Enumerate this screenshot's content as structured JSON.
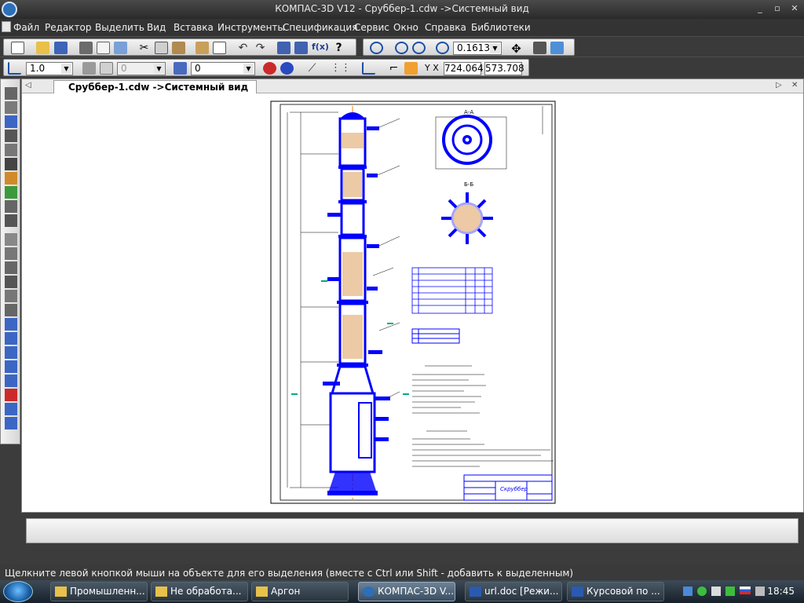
{
  "window": {
    "title": "КОМПАС-3D V12 - Сруббер-1.cdw ->Системный вид",
    "minimize": "_",
    "maximize": "▫",
    "close": "✕"
  },
  "menu": [
    "Файл",
    "Редактор",
    "Выделить",
    "Вид",
    "Вставка",
    "Инструменты",
    "Спецификация",
    "Сервис",
    "Окно",
    "Справка",
    "Библиотеки"
  ],
  "toolbar": {
    "zoom_value": "0.1613",
    "line_scale": "1.0",
    "layer_value": "0",
    "style_value": "0",
    "coord_x": "724.064",
    "coord_y": "573.708",
    "axis_label": "Y X"
  },
  "document": {
    "tab_label": "Сруббер-1.cdw ->Системный вид"
  },
  "drawing": {
    "section_aa": "А-А",
    "section_bb": "Б-Б",
    "title_block_name": "Скруббер"
  },
  "status": {
    "hint": "Щелкните левой кнопкой мыши на объекте для его выделения (вместе с Ctrl или Shift - добавить к выделенным)"
  },
  "taskbar": {
    "items": [
      "Промышленн...",
      "Не обработа...",
      "Аргон",
      "КОМПАС-3D V...",
      "url.doc [Режи...",
      "Курсовой по ..."
    ],
    "clock": "18:45"
  },
  "colors": {
    "drawing_blue": "#0000ff",
    "axis_orange": "#ff8000",
    "hatch_orange": "#cc6600"
  }
}
